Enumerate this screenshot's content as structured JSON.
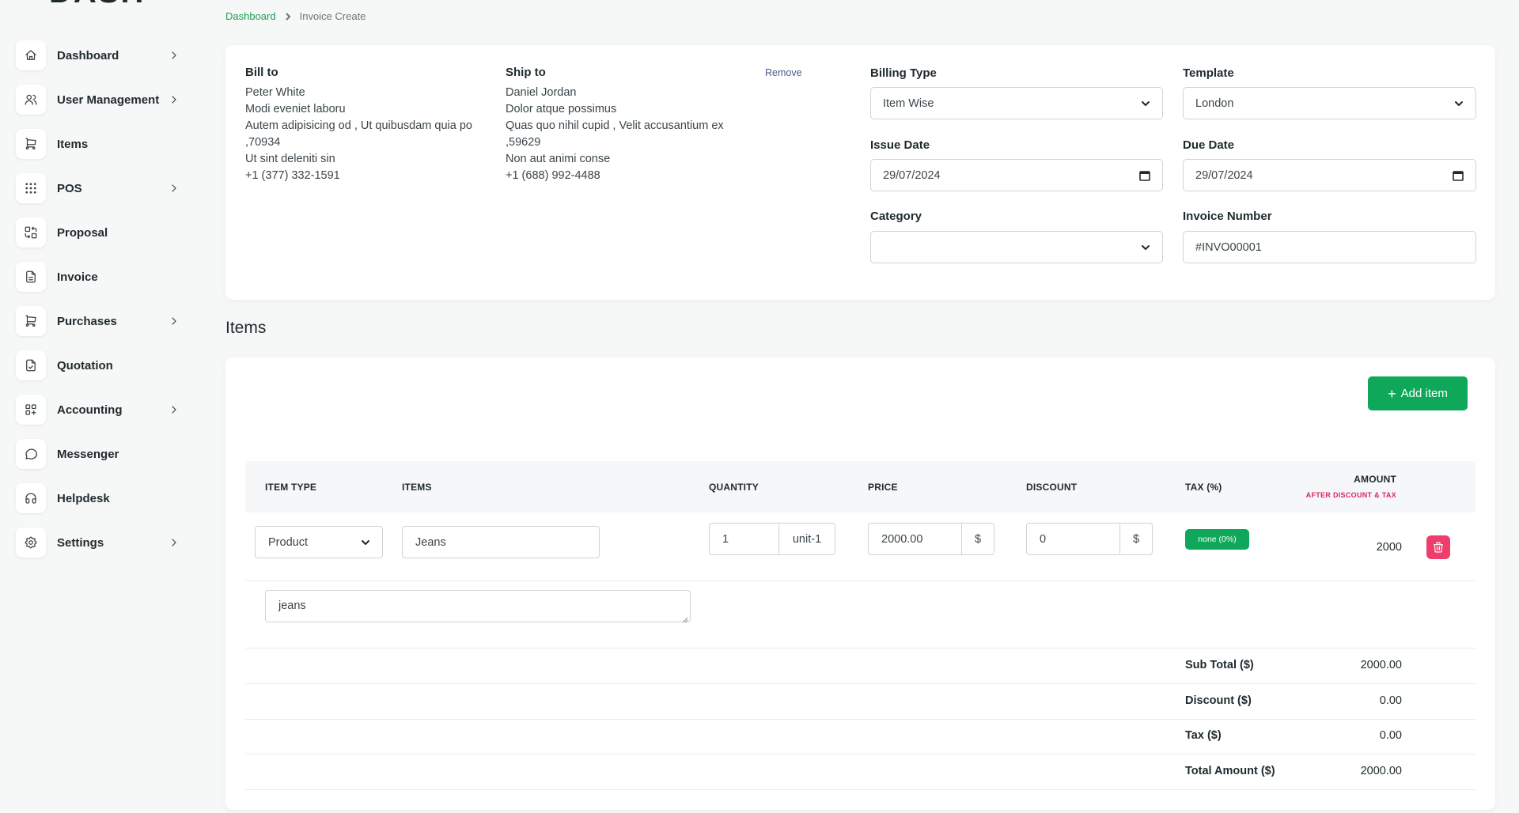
{
  "sidebar": {
    "items": [
      {
        "label": "Dashboard",
        "icon": "home-icon",
        "has_children": true
      },
      {
        "label": "User Management",
        "icon": "users-icon",
        "has_children": true
      },
      {
        "label": "Items",
        "icon": "cart-icon",
        "has_children": false
      },
      {
        "label": "POS",
        "icon": "grid-dots-icon",
        "has_children": true
      },
      {
        "label": "Proposal",
        "icon": "swap-icon",
        "has_children": false
      },
      {
        "label": "Invoice",
        "icon": "file-invoice-icon",
        "has_children": false
      },
      {
        "label": "Purchases",
        "icon": "cart-icon",
        "has_children": true
      },
      {
        "label": "Quotation",
        "icon": "file-check-icon",
        "has_children": false
      },
      {
        "label": "Accounting",
        "icon": "apps-plus-icon",
        "has_children": true
      },
      {
        "label": "Messenger",
        "icon": "message-icon",
        "has_children": false
      },
      {
        "label": "Helpdesk",
        "icon": "headphones-icon",
        "has_children": false
      },
      {
        "label": "Settings",
        "icon": "gear-icon",
        "has_children": true
      }
    ]
  },
  "breadcrumb": {
    "home": "Dashboard",
    "current": "Invoice Create"
  },
  "bill_to": {
    "title": "Bill to",
    "lines": [
      "Peter White",
      "Modi eveniet laboru",
      "Autem adipisicing od , Ut quibusdam quia po",
      ",70934",
      "Ut sint deleniti sin",
      "+1 (377) 332-1591"
    ]
  },
  "ship_to": {
    "title": "Ship to",
    "remove_label": "Remove",
    "lines": [
      "Daniel Jordan",
      "Dolor atque possimus",
      "Quas quo nihil cupid , Velit accusantium ex",
      ",59629",
      "Non aut animi conse",
      "+1 (688) 992-4488"
    ]
  },
  "form": {
    "billing_type": {
      "label": "Billing Type",
      "value": "Item Wise"
    },
    "template": {
      "label": "Template",
      "value": "London"
    },
    "issue_date": {
      "label": "Issue Date",
      "value": "29/07/2024"
    },
    "due_date": {
      "label": "Due Date",
      "value": "29/07/2024"
    },
    "category": {
      "label": "Category",
      "value": ""
    },
    "invoice_number": {
      "label": "Invoice Number",
      "value": "#INVO00001"
    }
  },
  "items_section": {
    "title": "Items",
    "add_button": "Add item",
    "columns": {
      "item_type": "ITEM TYPE",
      "items": "ITEMS",
      "quantity": "QUANTITY",
      "price": "PRICE",
      "discount": "DISCOUNT",
      "tax": "TAX (%)",
      "amount": "AMOUNT",
      "amount_sub": "AFTER DISCOUNT & TAX"
    },
    "row": {
      "item_type": "Product",
      "item": "Jeans",
      "quantity": "1",
      "unit": "unit-1",
      "price": "2000.00",
      "price_currency": "$",
      "discount": "0",
      "discount_currency": "$",
      "tax": "none (0%)",
      "amount": "2000",
      "description": "jeans"
    },
    "summary": [
      {
        "label": "Sub Total ($)",
        "value": "2000.00"
      },
      {
        "label": "Discount ($)",
        "value": "0.00"
      },
      {
        "label": "Tax ($)",
        "value": "0.00"
      },
      {
        "label": "Total Amount ($)",
        "value": "2000.00"
      }
    ]
  },
  "colors": {
    "accent": "#0fa85a",
    "danger": "#ef3e6c",
    "link": "#1e9e55"
  }
}
